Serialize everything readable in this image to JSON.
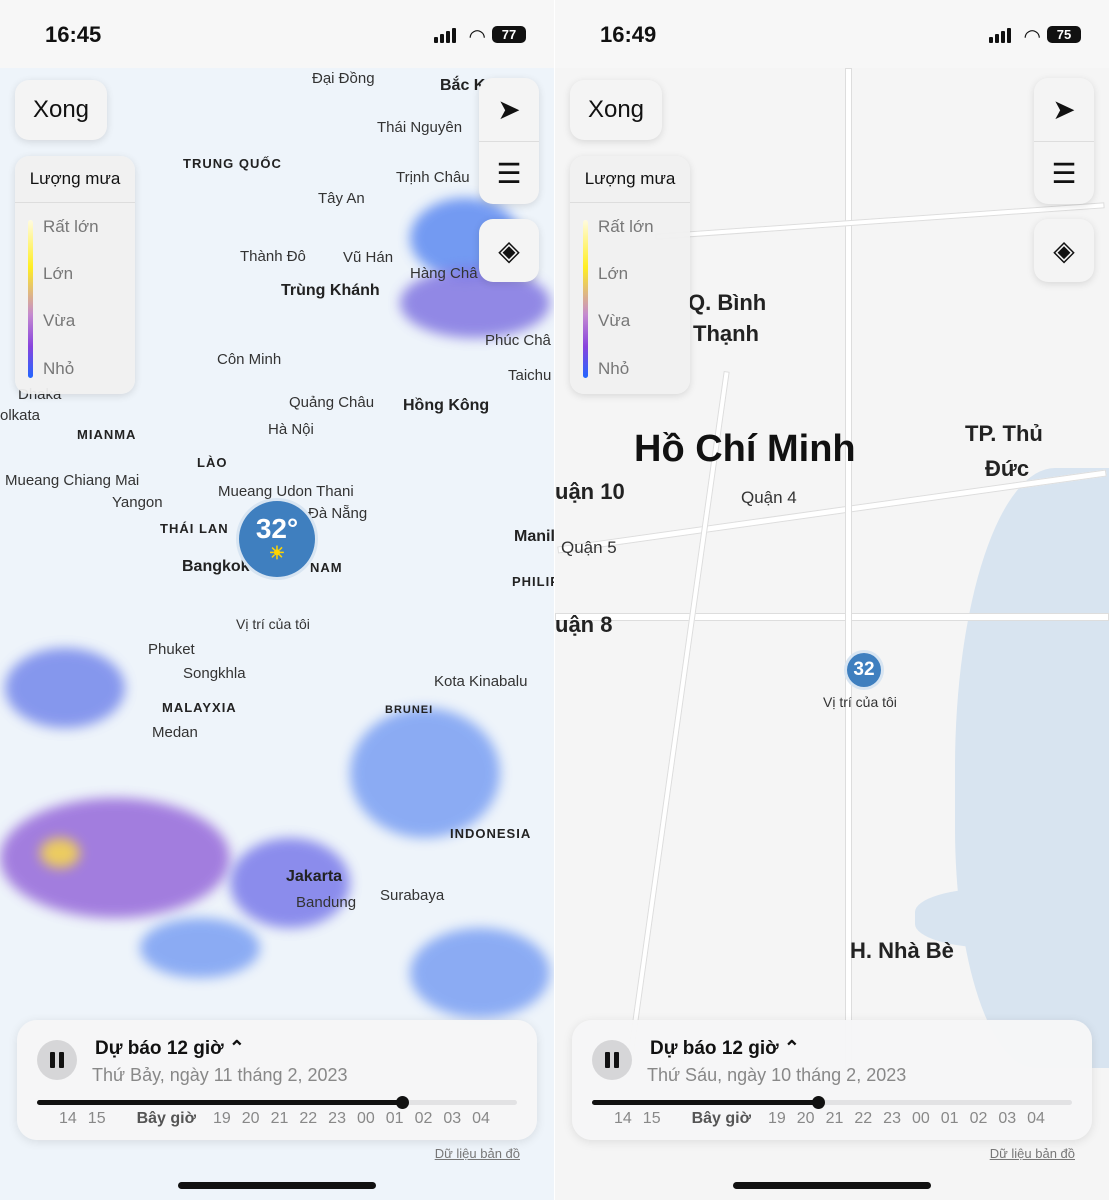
{
  "left": {
    "status": {
      "time": "16:45",
      "battery": "77"
    },
    "done_label": "Xong",
    "legend": {
      "title": "Lượng mưa",
      "levels": [
        "Rất lớn",
        "Lớn",
        "Vừa",
        "Nhỏ"
      ]
    },
    "map_labels": [
      "Đại Đồng",
      "Bắc K",
      "Thái Nguyên",
      "TRUNG QUỐC",
      "Trịnh Châu",
      "Tây An",
      "Thành Đô",
      "Vũ Hán",
      "Hàng Châ",
      "Trùng Khánh",
      "Côn Minh",
      "Phúc Châ",
      "Taichu",
      "Dhaka",
      "olkata",
      "MIANMA",
      "Quảng Châu",
      "Hồng Kông",
      "Hà Nội",
      "LÀO",
      "Mueang Chiang Mai",
      "Yangon",
      "Mueang Udon Thani",
      "Đà Nẵng",
      "THÁI LAN",
      "Bangkok",
      "NAM",
      "Manil",
      "PHILIP",
      "Vị trí của tôi",
      "Phuket",
      "Songkhla",
      "Kota Kinabalu",
      "MALAYXIA",
      "BRUNEI",
      "Medan",
      "INDONESIA",
      "Jakarta",
      "Bandung",
      "Surabaya"
    ],
    "location": {
      "temp": "32°",
      "icon": "sun-icon"
    },
    "panel": {
      "title": "Dự báo 12 giờ",
      "date": "Thứ Bảy, ngày 11 tháng 2, 2023",
      "progress": 0.76
    },
    "credit": "Dữ liệu bản đồ"
  },
  "right": {
    "status": {
      "time": "16:49",
      "battery": "75"
    },
    "done_label": "Xong",
    "legend": {
      "title": "Lượng mưa",
      "levels": [
        "Rất lớn",
        "Lớn",
        "Vừa",
        "Nhỏ"
      ]
    },
    "map_labels": [
      "Q. Bình",
      "Thạnh",
      "Hồ Chí Minh",
      "TP. Thủ",
      "Đức",
      "uận 10",
      "Quận 4",
      "Quận 5",
      "uận 8",
      "Vị trí của tôi",
      "H. Nhà Bè"
    ],
    "location": {
      "temp": "32"
    },
    "panel": {
      "title": "Dự báo 12 giờ",
      "date": "Thứ Sáu, ngày 10 tháng 2, 2023",
      "progress": 0.47
    },
    "credit": "Dữ liệu bản đồ"
  },
  "timeline": {
    "ticks": [
      "14",
      "15",
      "Bây giờ",
      "19",
      "20",
      "21",
      "22",
      "23",
      "00",
      "01",
      "02",
      "03",
      "04"
    ]
  },
  "colors": {
    "rain_light": "#4a7cf0",
    "rain_heavy": "#c060d0",
    "rain_max": "#ffee22",
    "location": "#3f7fbf"
  }
}
